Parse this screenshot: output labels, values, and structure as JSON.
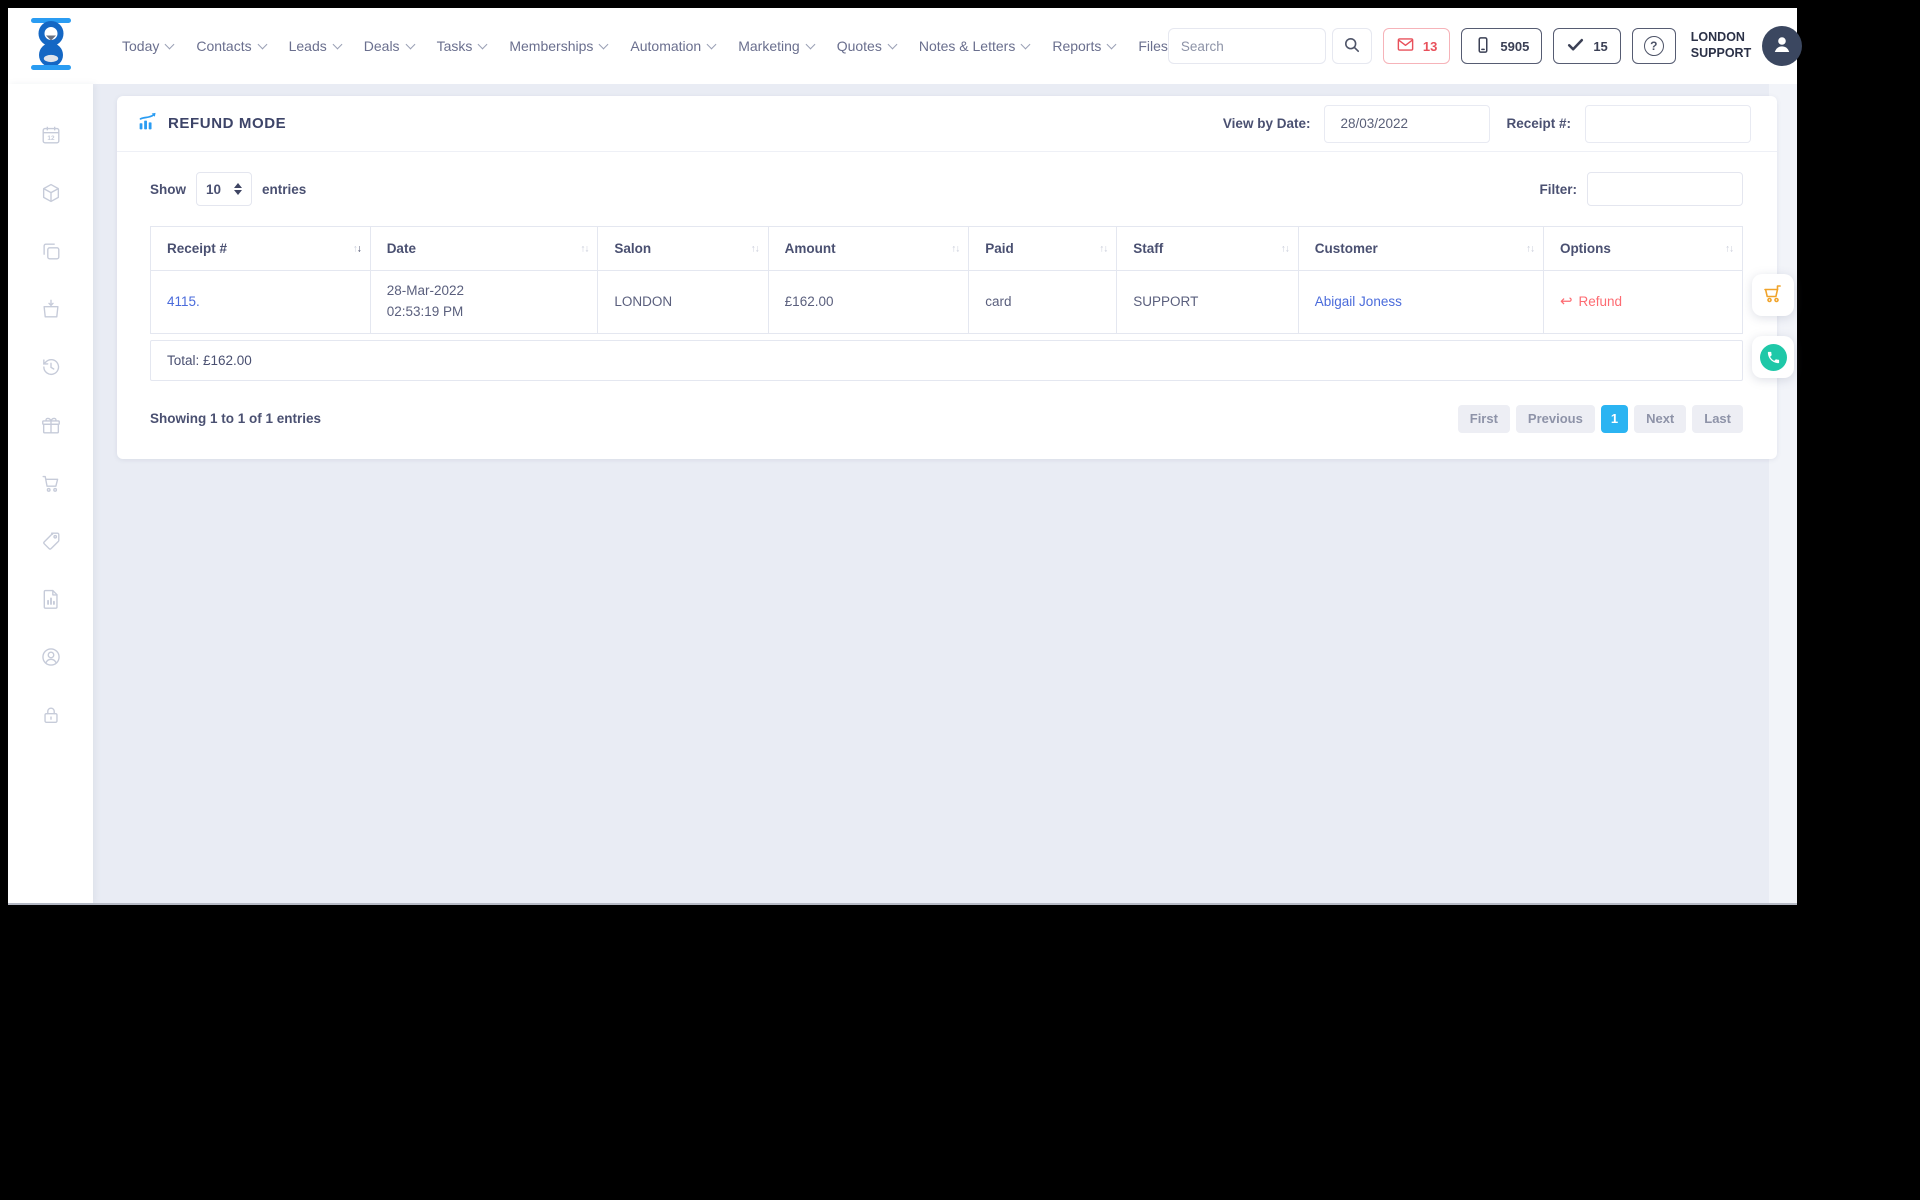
{
  "header": {
    "nav": [
      {
        "label": "Today"
      },
      {
        "label": "Contacts"
      },
      {
        "label": "Leads"
      },
      {
        "label": "Deals"
      },
      {
        "label": "Tasks"
      },
      {
        "label": "Memberships"
      },
      {
        "label": "Automation"
      },
      {
        "label": "Marketing"
      },
      {
        "label": "Quotes"
      },
      {
        "label": "Notes & Letters"
      },
      {
        "label": "Reports"
      },
      {
        "label": "Files"
      }
    ],
    "search": {
      "placeholder": "Search",
      "icon": "search-icon"
    },
    "badges": [
      {
        "icon": "envelope-icon",
        "count": "13",
        "style": "red"
      },
      {
        "icon": "mobile-phone-icon",
        "count": "5905",
        "style": "dark"
      },
      {
        "icon": "checkmark-icon",
        "count": "15",
        "style": "dark"
      }
    ],
    "help": {
      "icon": "question-mark-icon",
      "glyph": "?"
    },
    "user": {
      "name_line1": "LONDON",
      "name_line2": "SUPPORT",
      "avatar_icon": "user-avatar-icon"
    }
  },
  "sidebar": {
    "items": [
      {
        "icon": "calendar-icon"
      },
      {
        "icon": "package-icon"
      },
      {
        "icon": "copy-icon"
      },
      {
        "icon": "shopping-bag-icon"
      },
      {
        "icon": "history-icon"
      },
      {
        "icon": "gift-icon"
      },
      {
        "icon": "cart-icon"
      },
      {
        "icon": "tag-icon"
      },
      {
        "icon": "report-file-icon"
      },
      {
        "icon": "account-icon"
      },
      {
        "icon": "lock-icon"
      }
    ]
  },
  "page": {
    "title": "REFUND MODE",
    "title_icon": "chart-growth-icon",
    "view_by_date_label": "View by Date:",
    "date_value": "28/03/2022",
    "receipt_filter_label": "Receipt #:",
    "receipt_filter_value": "",
    "show_label": "Show",
    "show_value": "10",
    "entries_label": "entries",
    "filter_label": "Filter:",
    "filter_value": "",
    "table": {
      "columns": [
        "Receipt #",
        "Date",
        "Salon",
        "Amount",
        "Paid",
        "Staff",
        "Customer",
        "Options"
      ],
      "sorted_column": "Receipt #",
      "sort_direction": "descending",
      "row": {
        "receipt": "4115.",
        "date_line1": "28-Mar-2022",
        "date_line2": "02:53:19 PM",
        "salon": "LONDON",
        "amount": "£162.00",
        "paid": "card",
        "staff": "SUPPORT",
        "customer": "Abigail Joness",
        "refund_label": "Refund",
        "refund_arrow": "↩"
      },
      "total": "Total: £162.00"
    },
    "footer": {
      "showing_text": "Showing 1 to 1 of 1 entries",
      "pagination": [
        "First",
        "Previous",
        "1",
        "Next",
        "Last"
      ],
      "active_page": "1"
    }
  },
  "floating": [
    {
      "icon": "cart-orange-icon"
    },
    {
      "icon": "whatsapp-icon"
    }
  ],
  "colors": {
    "accent_blue": "#2a9cf2",
    "logo_dark_blue": "#1467c4",
    "link_blue": "#4a6bdb",
    "refund_red": "#fd6b72",
    "badge_red": "#e8505b",
    "pagination_active": "#2bb4f2",
    "whatsapp_green": "#1fc8a8",
    "cart_orange": "#f0a32a",
    "main_bg": "#e9ecf4",
    "dark_navy": "#3d4468"
  }
}
